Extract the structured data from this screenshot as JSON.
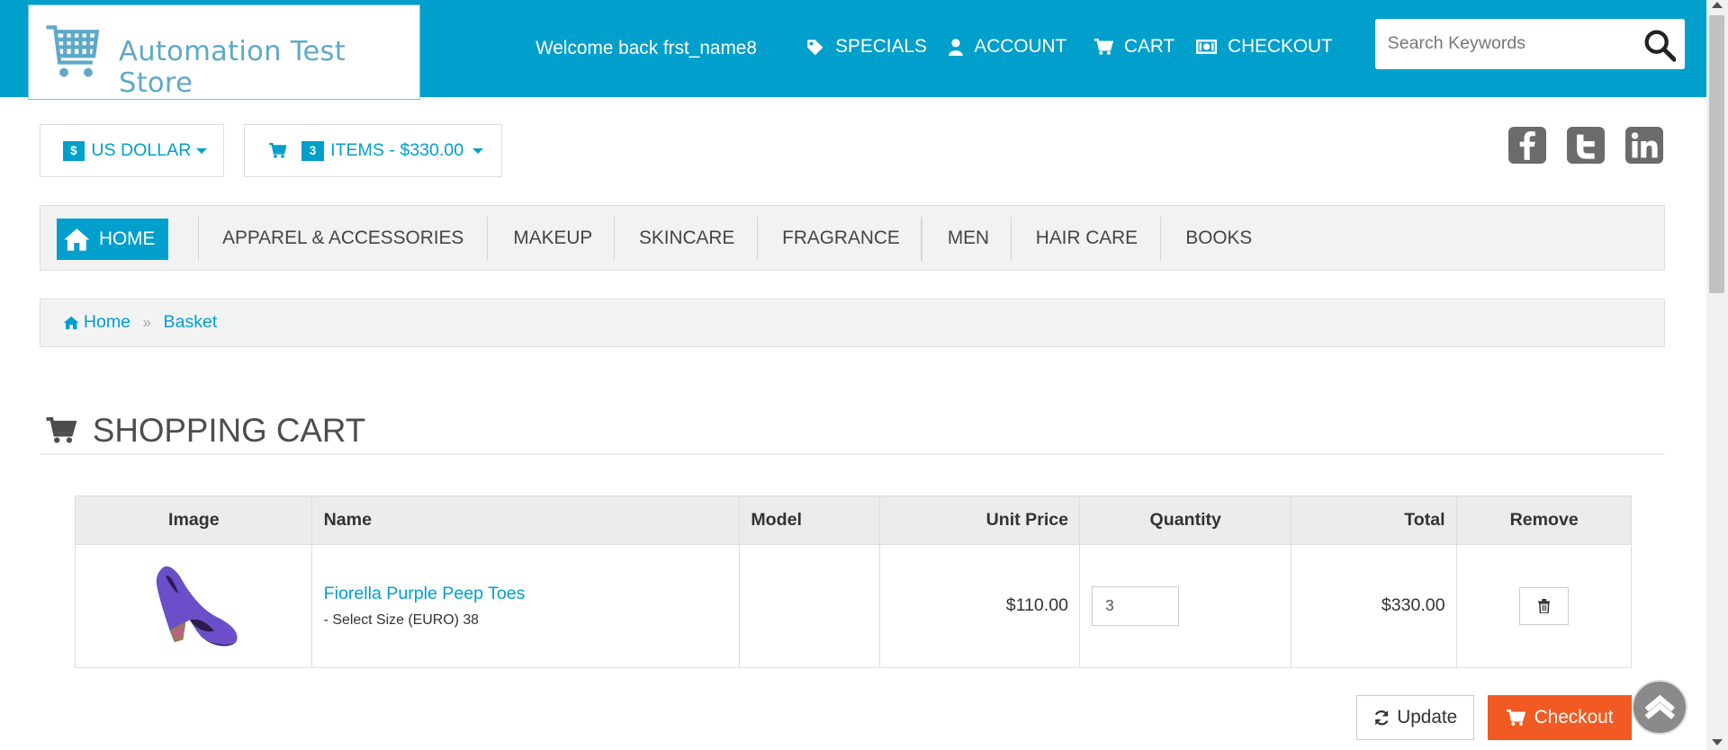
{
  "header": {
    "logo_text": "Automation Test Store",
    "welcome": "Welcome back frst_name8",
    "nav": {
      "specials": "SPECIALS",
      "account": "ACCOUNT",
      "cart": "CART",
      "checkout": "CHECKOUT"
    },
    "search_placeholder": "Search Keywords"
  },
  "currency": {
    "symbol": "$",
    "label": "US DOLLAR"
  },
  "mini_cart": {
    "count": "3",
    "label": "ITEMS - $330.00"
  },
  "categories": {
    "home": "HOME",
    "items": [
      "APPAREL & ACCESSORIES",
      "MAKEUP",
      "SKINCARE",
      "FRAGRANCE",
      "MEN",
      "HAIR CARE",
      "BOOKS"
    ]
  },
  "breadcrumb": {
    "home": "Home",
    "current": "Basket"
  },
  "page_title": "SHOPPING CART",
  "table": {
    "headers": [
      "Image",
      "Name",
      "Model",
      "Unit Price",
      "Quantity",
      "Total",
      "Remove"
    ],
    "rows": [
      {
        "name": "Fiorella Purple Peep Toes",
        "option_dash": "-",
        "option": "Select Size (EURO) 38",
        "model": "",
        "unit_price": "$110.00",
        "quantity": "3",
        "total": "$330.00"
      }
    ]
  },
  "buttons": {
    "update": "Update",
    "checkout": "Checkout"
  },
  "colors": {
    "brand": "#009fcc",
    "checkout": "#f15a22",
    "nav_bg": "#f2f2f2"
  },
  "icons": [
    "cart-logo-icon",
    "tag-icon",
    "user-icon",
    "cart-icon",
    "money-icon",
    "search-icon",
    "facebook-icon",
    "twitter-icon",
    "linkedin-icon",
    "home-icon",
    "trash-icon",
    "refresh-icon",
    "chevron-up-icon"
  ]
}
